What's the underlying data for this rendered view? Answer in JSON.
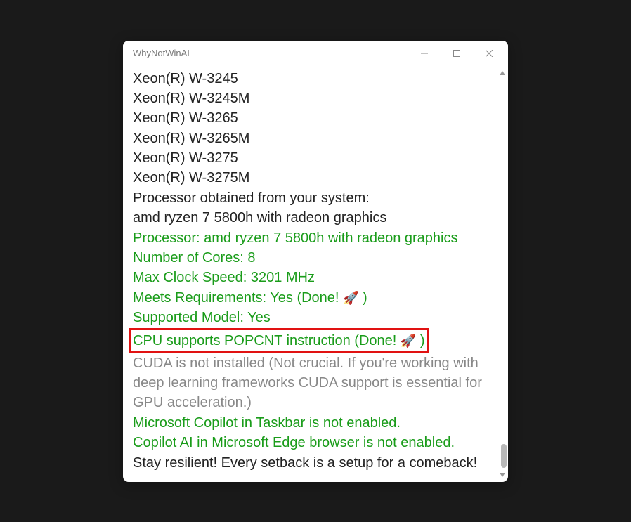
{
  "window": {
    "title": "WhyNotWinAI"
  },
  "lines": {
    "l0": "Xeon(R) W-3245",
    "l1": "Xeon(R) W-3245M",
    "l2": "Xeon(R) W-3265",
    "l3": "Xeon(R) W-3265M",
    "l4": "Xeon(R) W-3275",
    "l5": "Xeon(R) W-3275M",
    "l6": "Processor obtained from your system:",
    "l7": "amd ryzen 7 5800h with radeon graphics",
    "l8": "Processor: amd ryzen 7 5800h with radeon graphics",
    "l9": "Number of Cores: 8",
    "l10": "Max Clock Speed: 3201 MHz",
    "l11_pre": "Meets Requirements: Yes (Done! ",
    "l11_post": " )",
    "l12": "Supported Model: Yes",
    "l13_pre": "CPU supports POPCNT instruction (Done! ",
    "l13_post": " )",
    "l14": "CUDA is not installed (Not crucial. If you're working with deep learning frameworks CUDA support is essential for GPU acceleration.)",
    "l15": "Microsoft Copilot in Taskbar is not enabled.",
    "l16": "Copilot AI in Microsoft Edge browser is not enabled.",
    "l17": "Stay resilient! Every setback is a setup for a comeback!"
  },
  "icons": {
    "rocket": "🚀"
  }
}
